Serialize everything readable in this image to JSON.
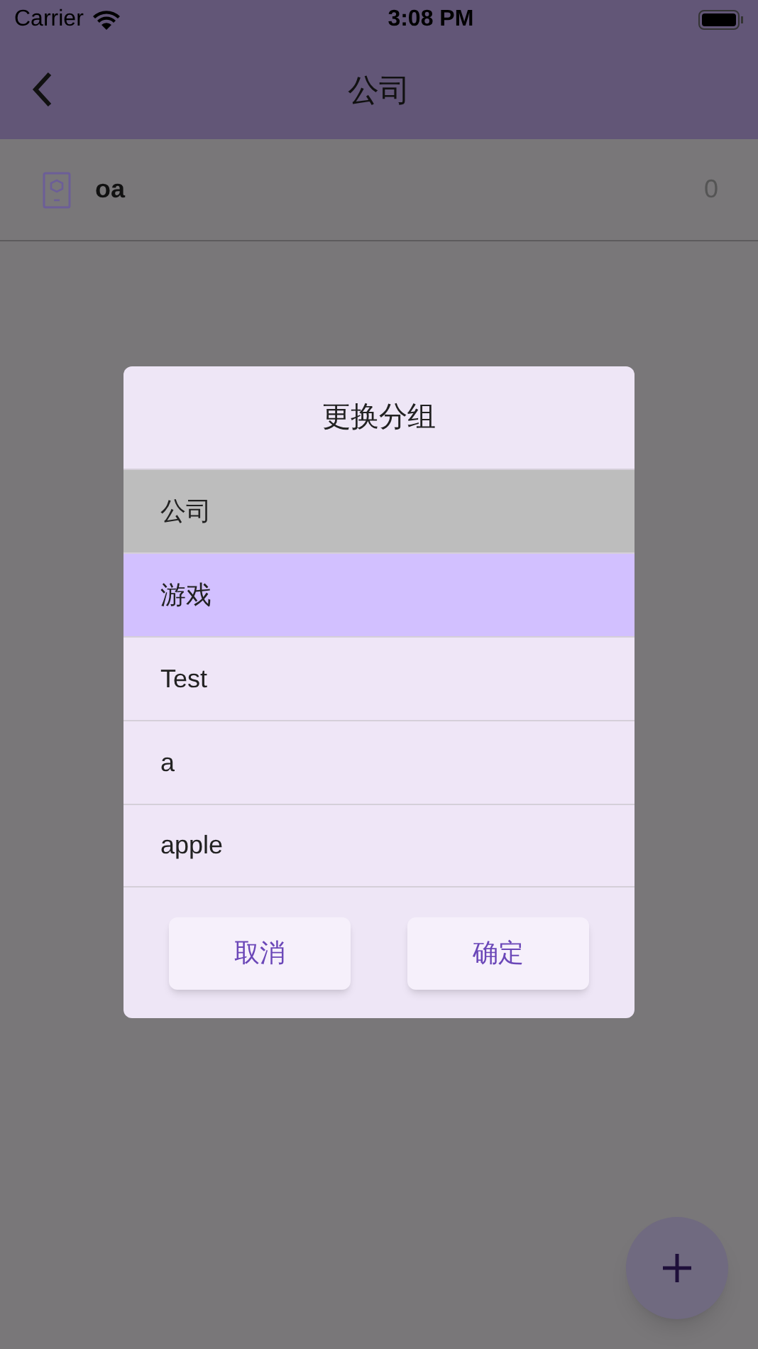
{
  "status_bar": {
    "carrier": "Carrier",
    "time": "3:08 PM"
  },
  "app_bar": {
    "title": "公司"
  },
  "list": [
    {
      "name": "oa",
      "count": "0"
    }
  ],
  "dialog": {
    "title": "更换分组",
    "options": [
      {
        "label": "公司",
        "current": true,
        "selected": false
      },
      {
        "label": "游戏",
        "current": false,
        "selected": true
      },
      {
        "label": "Test",
        "current": false,
        "selected": false
      },
      {
        "label": "a",
        "current": false,
        "selected": false
      },
      {
        "label": "apple",
        "current": false,
        "selected": false
      }
    ],
    "buttons": [
      {
        "label": "取消"
      },
      {
        "label": "确定"
      }
    ]
  }
}
